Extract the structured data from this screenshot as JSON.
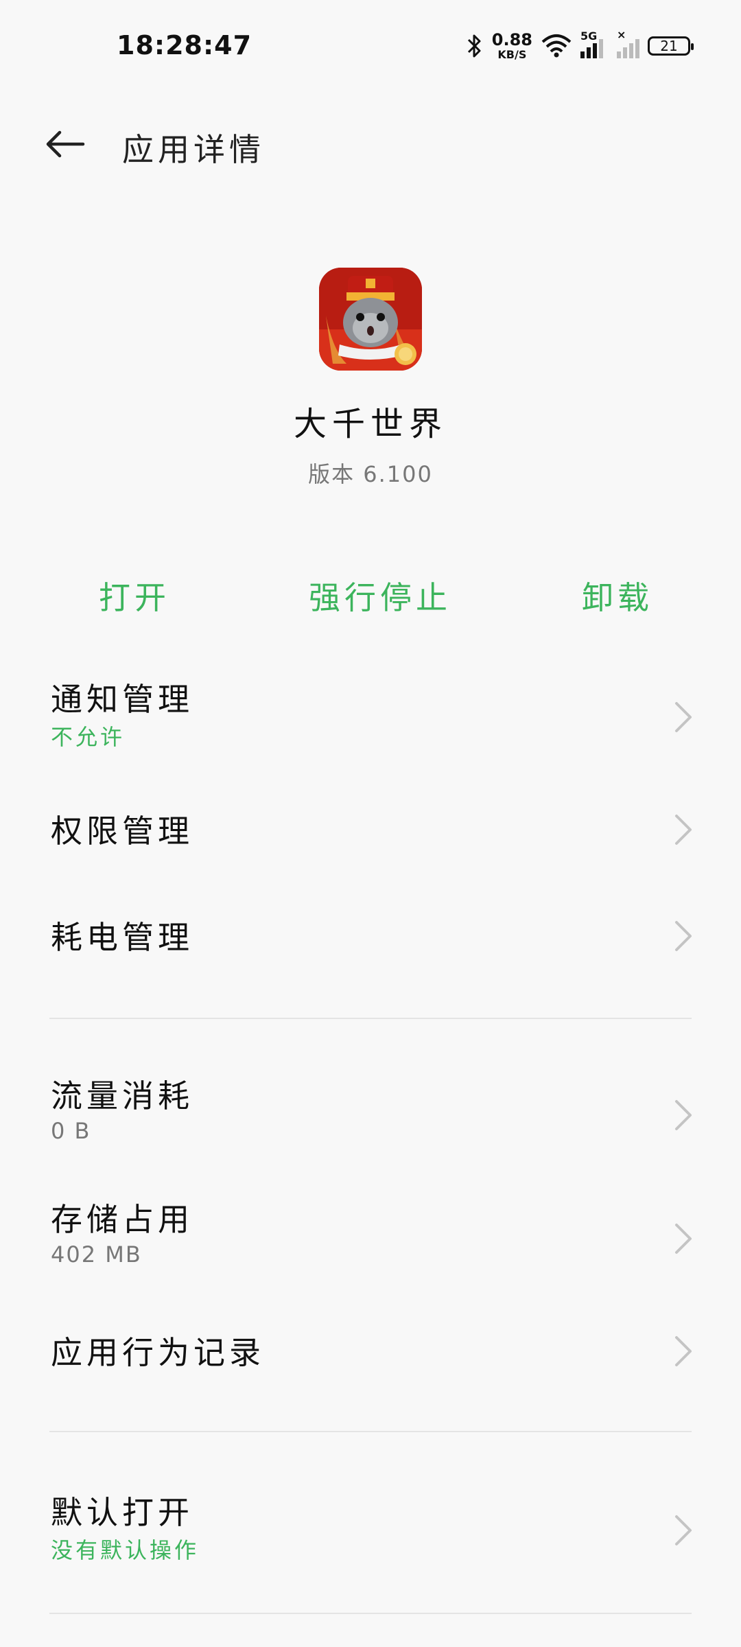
{
  "status_bar": {
    "time": "18:28:47",
    "net_speed_value": "0.88",
    "net_speed_unit": "KB/S",
    "cell_label": "5G",
    "battery_level": "21"
  },
  "header": {
    "title": "应用详情"
  },
  "app": {
    "name": "大千世界",
    "version": "版本 6.100"
  },
  "actions": {
    "open": "打开",
    "force_stop": "强行停止",
    "uninstall": "卸载"
  },
  "settings": [
    {
      "title": "通知管理",
      "subtitle": "不允许",
      "subtitle_style": "green"
    },
    {
      "title": "权限管理"
    },
    {
      "title": "耗电管理"
    },
    {
      "title": "流量消耗",
      "subtitle": "0 B",
      "subtitle_style": "gray"
    },
    {
      "title": "存储占用",
      "subtitle": "402 MB",
      "subtitle_style": "gray"
    },
    {
      "title": "应用行为记录"
    },
    {
      "title": "默认打开",
      "subtitle": "没有默认操作",
      "subtitle_style": "green"
    }
  ],
  "colors": {
    "accent": "#3cb45c",
    "background": "#f8f8f8",
    "divider": "#e4e4e4"
  },
  "icons": [
    "bluetooth-icon",
    "wifi-icon",
    "cell-signal-icon",
    "battery-icon",
    "back-arrow-icon",
    "chevron-right-icon"
  ]
}
